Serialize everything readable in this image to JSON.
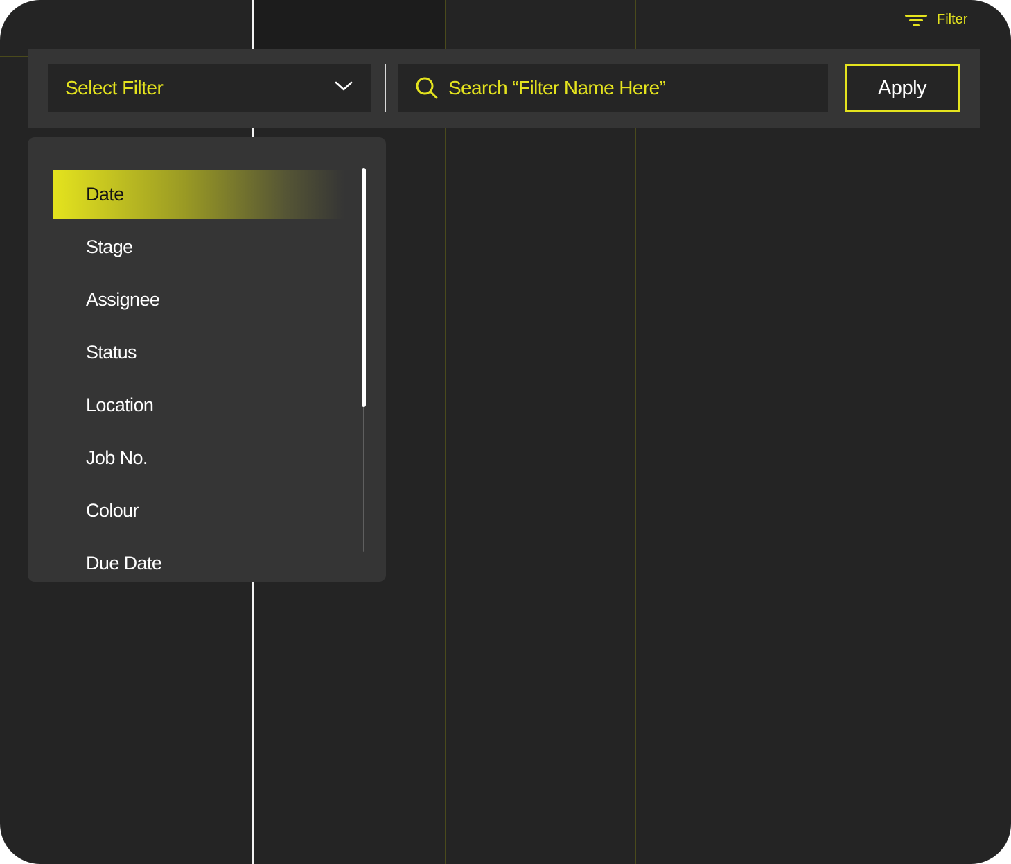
{
  "top_filter": {
    "label": "Filter",
    "icon": "filter-icon"
  },
  "toolbar": {
    "select": {
      "label": "Select Filter",
      "icon": "chevron-down-icon"
    },
    "search": {
      "placeholder": "Search “Filter Name Here”",
      "icon": "search-icon"
    },
    "apply_label": "Apply"
  },
  "dropdown": {
    "items": [
      {
        "label": "Date",
        "active": true
      },
      {
        "label": "Stage"
      },
      {
        "label": "Assignee"
      },
      {
        "label": "Status"
      },
      {
        "label": "Location"
      },
      {
        "label": "Job No."
      },
      {
        "label": "Colour"
      },
      {
        "label": "Due Date"
      }
    ]
  },
  "colors": {
    "accent": "#e4e31e",
    "background": "#242424",
    "panel": "#353535",
    "field": "#252525"
  }
}
